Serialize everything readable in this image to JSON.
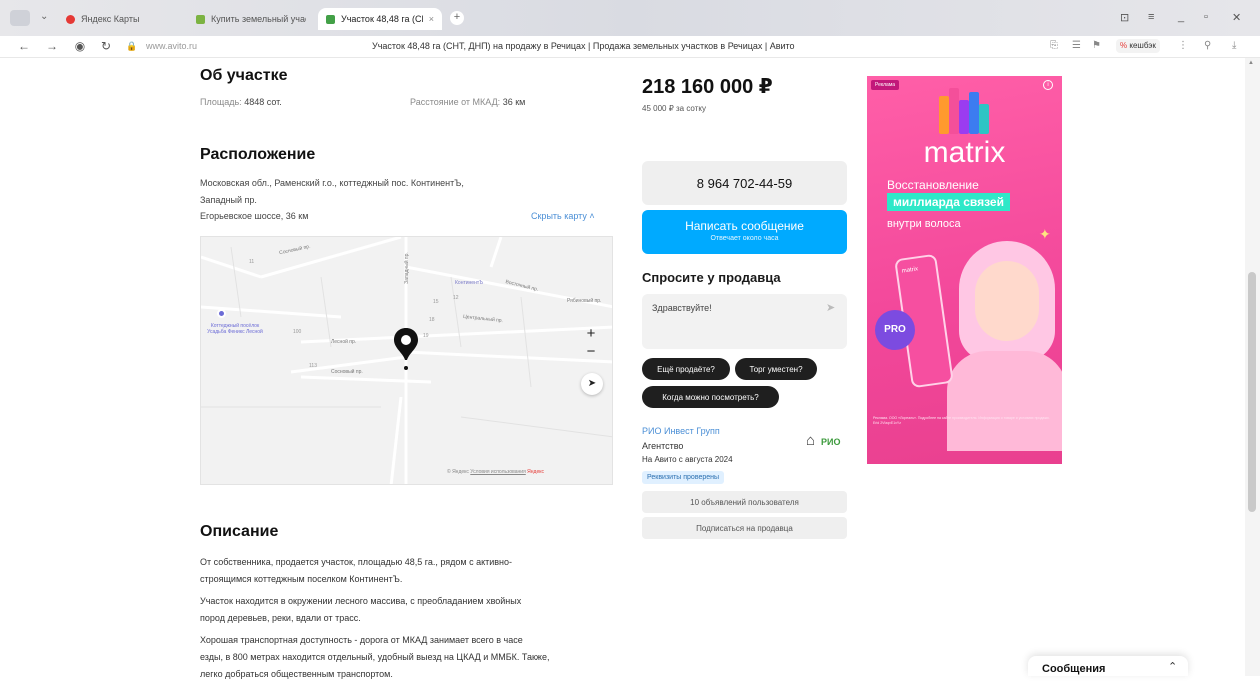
{
  "browser": {
    "tabs": [
      {
        "label": "Яндекс Карты"
      },
      {
        "label": "Купить земельный участ"
      },
      {
        "label": "Участок 48,48 га (СНТ,"
      }
    ],
    "address": "www.avito.ru",
    "page_title": "Участок 48,48 га (СНТ, ДНП) на продажу в Речицах | Продажа земельных участков в Речицах | Авито",
    "cashback": "кешбэк"
  },
  "about": {
    "title": "Об участке",
    "area_label": "Площадь:",
    "area_value": "4848 сот.",
    "mkad_label": "Расстояние от МКАД:",
    "mkad_value": "36 км"
  },
  "location": {
    "title": "Расположение",
    "address_line1": "Московская обл., Раменский г.о., коттеджный пос. КонтинентЪ,",
    "address_line2": "Западный пр.",
    "highway": "Егорьевское шоссе, 36 км",
    "hide_map": "Скрыть карту"
  },
  "map": {
    "labels": {
      "sosnovy": "Сосновый пр.",
      "zapadny": "Западный пр.",
      "kontinent": "КонтинентЪ",
      "vostochny": "Восточный пр.",
      "ryabinovy": "Рябиновый пр.",
      "tsentralny": "Центральный пр.",
      "lesnoy": "Лесной пр.",
      "sosnovy2": "Сосновый пр.",
      "village": "Коттеджный посёлок Усадьба Феникс Лесной",
      "n11": "11",
      "n12": "12",
      "n15": "15",
      "n18": "18",
      "n19": "19",
      "n100": "100",
      "n113": "113"
    },
    "zoom_in": "+",
    "zoom_out": "−",
    "copyright": "© Яндекс",
    "terms": "Условия использования",
    "brand": "Яндекс"
  },
  "price": {
    "value": "218 160 000 ₽",
    "per_unit": "45 000 ₽ за сотку"
  },
  "contact": {
    "phone": "8 964 702-44-59",
    "write_label": "Написать сообщение",
    "write_sub": "Отвечает около часа",
    "ask_title": "Спросите у продавца",
    "message_placeholder": "Здравствуйте!",
    "chips": [
      "Ещё продаёте?",
      "Торг уместен?",
      "Когда можно посмотреть?"
    ]
  },
  "seller": {
    "name": "РИО Инвест Групп",
    "type": "Агентство",
    "since": "На Авито с августа 2024",
    "badge": "Реквизиты проверены",
    "logo_text": "РИО",
    "listings_btn": "10 объявлений пользователя",
    "subscribe_btn": "Подписаться на продавца"
  },
  "ad": {
    "badge": "Реклама",
    "brand": "matrix",
    "line1": "Восстановление",
    "line2": "миллиарда связей",
    "line3": "внутри волоса",
    "pro": "PRO",
    "fine_print": "Реклама. ООО «Лореаль». Подробнее на сайте производителя. Информация о товаре и условиях продажи. Erid 2VtzqvE1xYz"
  },
  "description": {
    "title": "Описание",
    "p1_line1": "От собственника, продается участок, площадью 48,5 га., рядом с активно-",
    "p1_line2": "строящимся коттеджным поселком КонтинентЪ.",
    "p2_line1": "Участок находится в окружении лесного массива, с преобладанием хвойных",
    "p2_line2": "пород деревьев, реки, вдали от трасс.",
    "p3_line1": "Хорошая транспортная доступность - дорога от МКАД занимает всего в часе",
    "p3_line2": "езды, в 800 метрах находится отдельный, удобный выезд на ЦКАД и ММБК. Также,",
    "p3_line3": "легко добраться общественным транспортом."
  },
  "messages": {
    "label": "Сообщения"
  },
  "colors": {
    "accent_blue": "#00aaff",
    "link_blue": "#1a73e8",
    "ad_pink": "#f2479a"
  }
}
